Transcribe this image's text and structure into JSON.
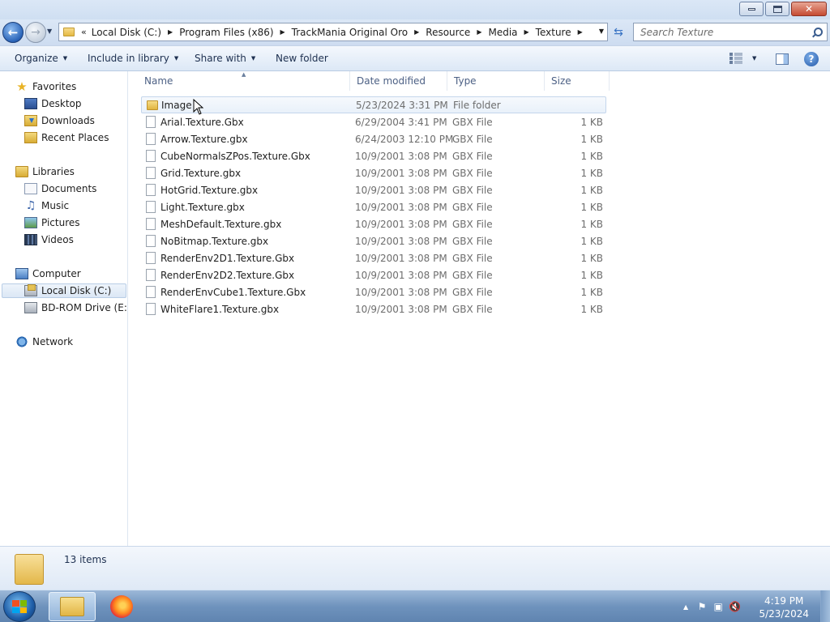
{
  "window": {
    "minimize_label": "",
    "maximize_label": "",
    "close_label": "✕"
  },
  "address": {
    "overflow_chevron": "«",
    "crumbs": [
      "Local Disk (C:)",
      "Program Files (x86)",
      "TrackMania Original Oro",
      "Resource",
      "Media",
      "Texture"
    ],
    "search_placeholder": "Search Texture"
  },
  "toolbar": {
    "organize": "Organize",
    "include_in_library": "Include in library",
    "share_with": "Share with",
    "new_folder": "New folder",
    "help": "?"
  },
  "nav": {
    "favorites": "Favorites",
    "desktop": "Desktop",
    "downloads": "Downloads",
    "recent_places": "Recent Places",
    "libraries": "Libraries",
    "documents": "Documents",
    "music": "Music",
    "pictures": "Pictures",
    "videos": "Videos",
    "computer": "Computer",
    "local_disk": "Local Disk (C:)",
    "bd_rom": "BD-ROM Drive (E:) T",
    "network": "Network"
  },
  "columns": {
    "name": "Name",
    "date_modified": "Date modified",
    "type": "Type",
    "size": "Size"
  },
  "files": [
    {
      "name": "Image",
      "date": "5/23/2024 3:31 PM",
      "type": "File folder",
      "size": "",
      "kind": "folder"
    },
    {
      "name": "Arial.Texture.Gbx",
      "date": "6/29/2004 3:41 PM",
      "type": "GBX File",
      "size": "1 KB",
      "kind": "file"
    },
    {
      "name": "Arrow.Texture.gbx",
      "date": "6/24/2003 12:10 PM",
      "type": "GBX File",
      "size": "1 KB",
      "kind": "file"
    },
    {
      "name": "CubeNormalsZPos.Texture.Gbx",
      "date": "10/9/2001 3:08 PM",
      "type": "GBX File",
      "size": "1 KB",
      "kind": "file"
    },
    {
      "name": "Grid.Texture.gbx",
      "date": "10/9/2001 3:08 PM",
      "type": "GBX File",
      "size": "1 KB",
      "kind": "file"
    },
    {
      "name": "HotGrid.Texture.gbx",
      "date": "10/9/2001 3:08 PM",
      "type": "GBX File",
      "size": "1 KB",
      "kind": "file"
    },
    {
      "name": "Light.Texture.gbx",
      "date": "10/9/2001 3:08 PM",
      "type": "GBX File",
      "size": "1 KB",
      "kind": "file"
    },
    {
      "name": "MeshDefault.Texture.gbx",
      "date": "10/9/2001 3:08 PM",
      "type": "GBX File",
      "size": "1 KB",
      "kind": "file"
    },
    {
      "name": "NoBitmap.Texture.gbx",
      "date": "10/9/2001 3:08 PM",
      "type": "GBX File",
      "size": "1 KB",
      "kind": "file"
    },
    {
      "name": "RenderEnv2D1.Texture.Gbx",
      "date": "10/9/2001 3:08 PM",
      "type": "GBX File",
      "size": "1 KB",
      "kind": "file"
    },
    {
      "name": "RenderEnv2D2.Texture.Gbx",
      "date": "10/9/2001 3:08 PM",
      "type": "GBX File",
      "size": "1 KB",
      "kind": "file"
    },
    {
      "name": "RenderEnvCube1.Texture.Gbx",
      "date": "10/9/2001 3:08 PM",
      "type": "GBX File",
      "size": "1 KB",
      "kind": "file"
    },
    {
      "name": "WhiteFlare1.Texture.gbx",
      "date": "10/9/2001 3:08 PM",
      "type": "GBX File",
      "size": "1 KB",
      "kind": "file"
    }
  ],
  "details": {
    "item_count": "13 items"
  },
  "taskbar": {
    "time": "4:19 PM",
    "date": "5/23/2024"
  }
}
